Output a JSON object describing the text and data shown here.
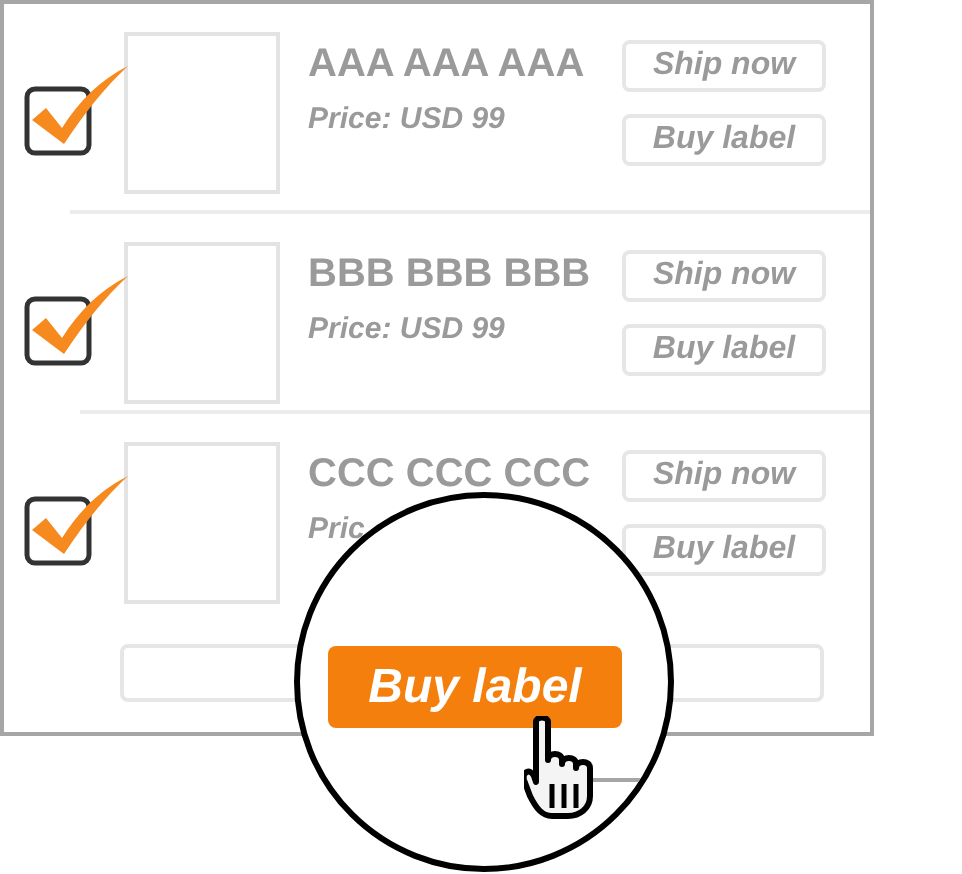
{
  "items": [
    {
      "title": "AAA AAA AAA",
      "price": "Price: USD 99",
      "checked": true,
      "actions": [
        "Ship now",
        "Buy label"
      ]
    },
    {
      "title": "BBB BBB BBB",
      "price": "Price: USD 99",
      "checked": true,
      "actions": [
        "Ship now",
        "Buy label"
      ]
    },
    {
      "title": "CCC CCC CCC",
      "price": "Pric",
      "checked": true,
      "actions": [
        "Ship now",
        "Buy label"
      ]
    }
  ],
  "magnifier": {
    "button": "Buy label"
  }
}
